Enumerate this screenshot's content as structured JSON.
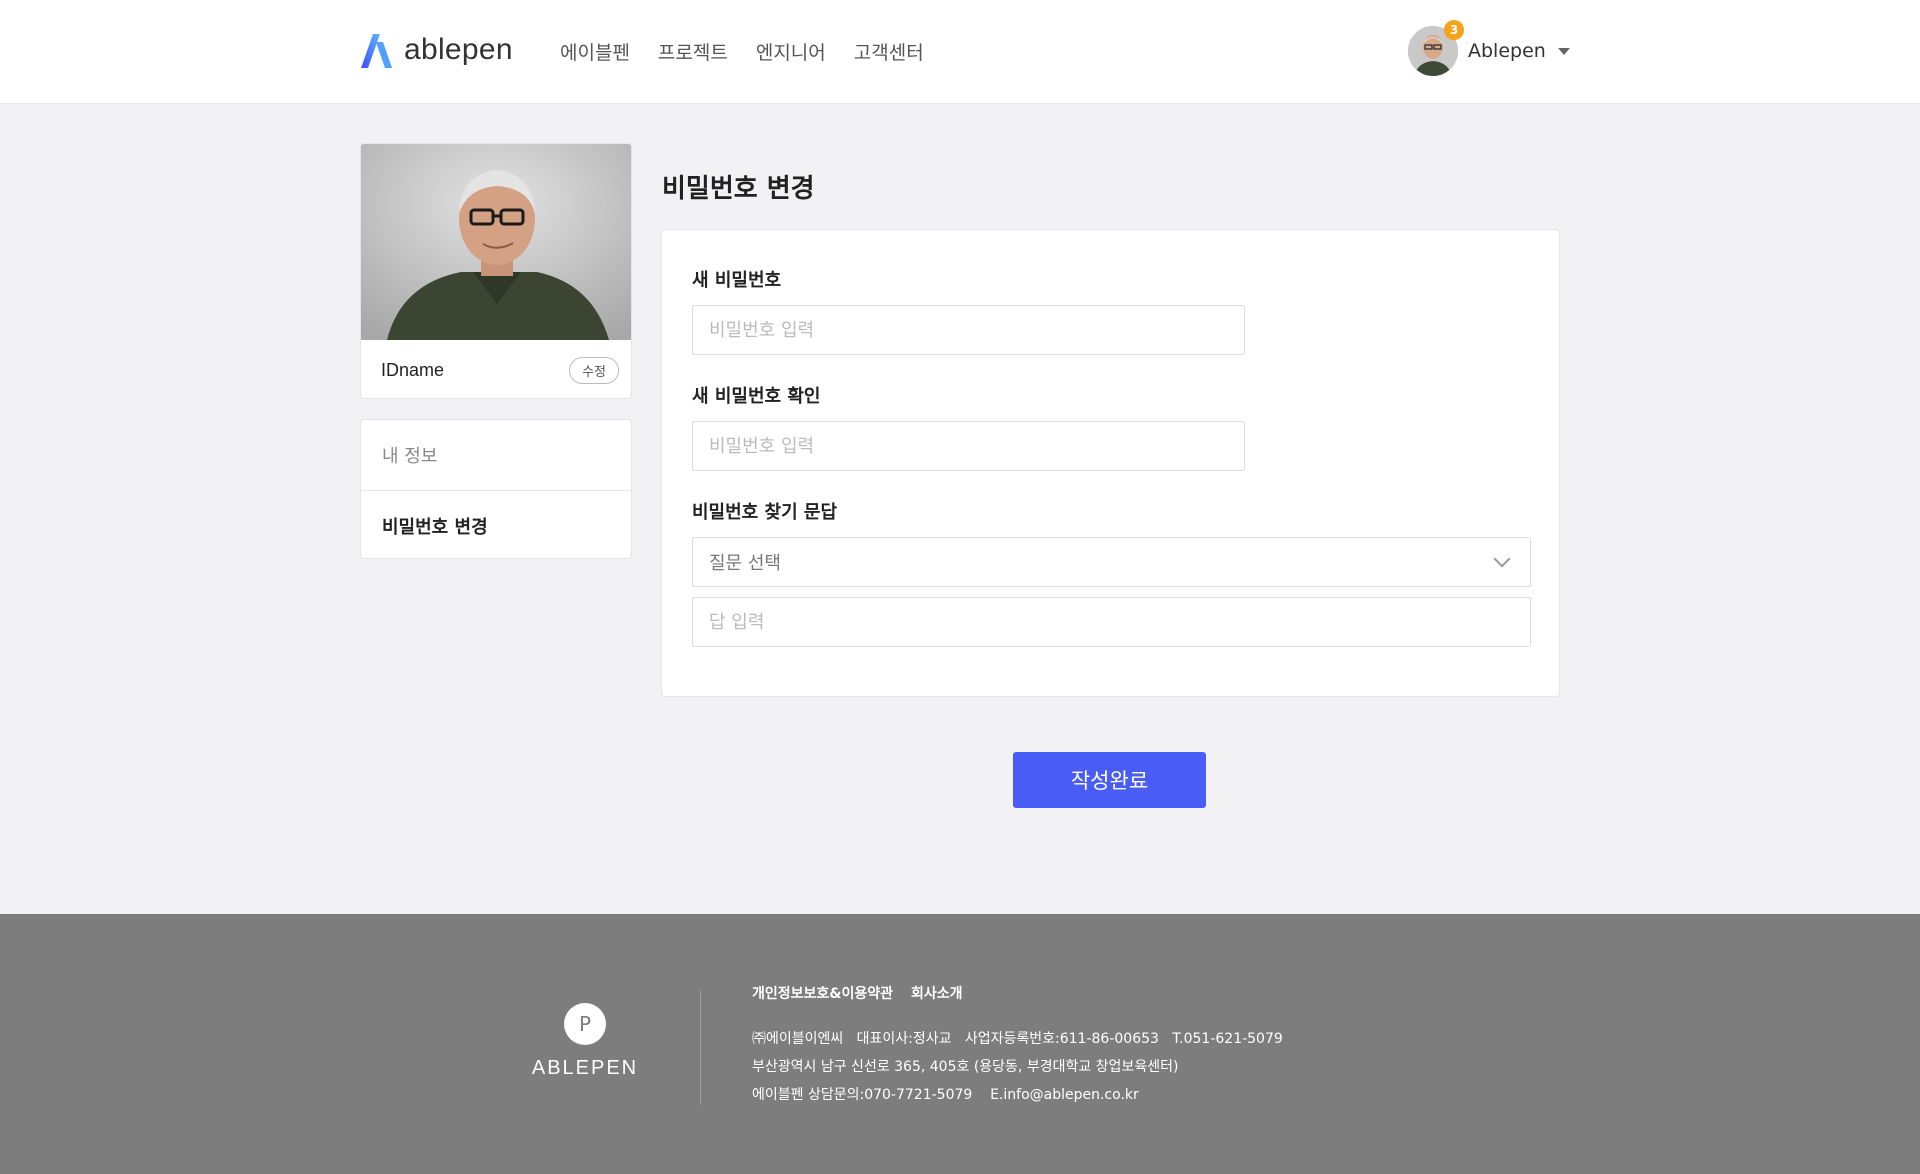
{
  "header": {
    "logo_text": "ablepen",
    "nav": [
      "에이블펜",
      "프로젝트",
      "엔지니어",
      "고객센터"
    ],
    "notification_count": "3",
    "user_name": "Ablepen"
  },
  "sidebar": {
    "profile_name": "IDname",
    "edit_label": "수정",
    "menu": [
      {
        "label": "내 정보",
        "active": false
      },
      {
        "label": "비밀번호 변경",
        "active": true
      }
    ]
  },
  "main": {
    "title": "비밀번호 변경",
    "new_password_label": "새 비밀번호",
    "new_password_placeholder": "비밀번호 입력",
    "confirm_label": "새 비밀번호 확인",
    "confirm_placeholder": "비밀번호 입력",
    "qa_label": "비밀번호 찾기 문답",
    "question_select": "질문 선택",
    "answer_placeholder": "답 입력",
    "submit_label": "작성완료"
  },
  "footer": {
    "logo_letter": "P",
    "brand": "ABLEPEN",
    "links": [
      "개인정보보호&이용약관",
      "회사소개"
    ],
    "line1": "㈜에이블이엔씨   대표이사:정사교   사업자등록번호:611-86-00653   T.051-621-5079",
    "line2": "부산광역시 남구 신선로 365, 405호 (용당동, 부경대학교 창업보육센터)",
    "line3": "에이블펜 상담문의:070-7721-5079    E.info@ablepen.co.kr"
  },
  "colors": {
    "accent": "#4a5cf6",
    "badge": "#f7a21b",
    "footer_bg": "#7d7d7d"
  }
}
